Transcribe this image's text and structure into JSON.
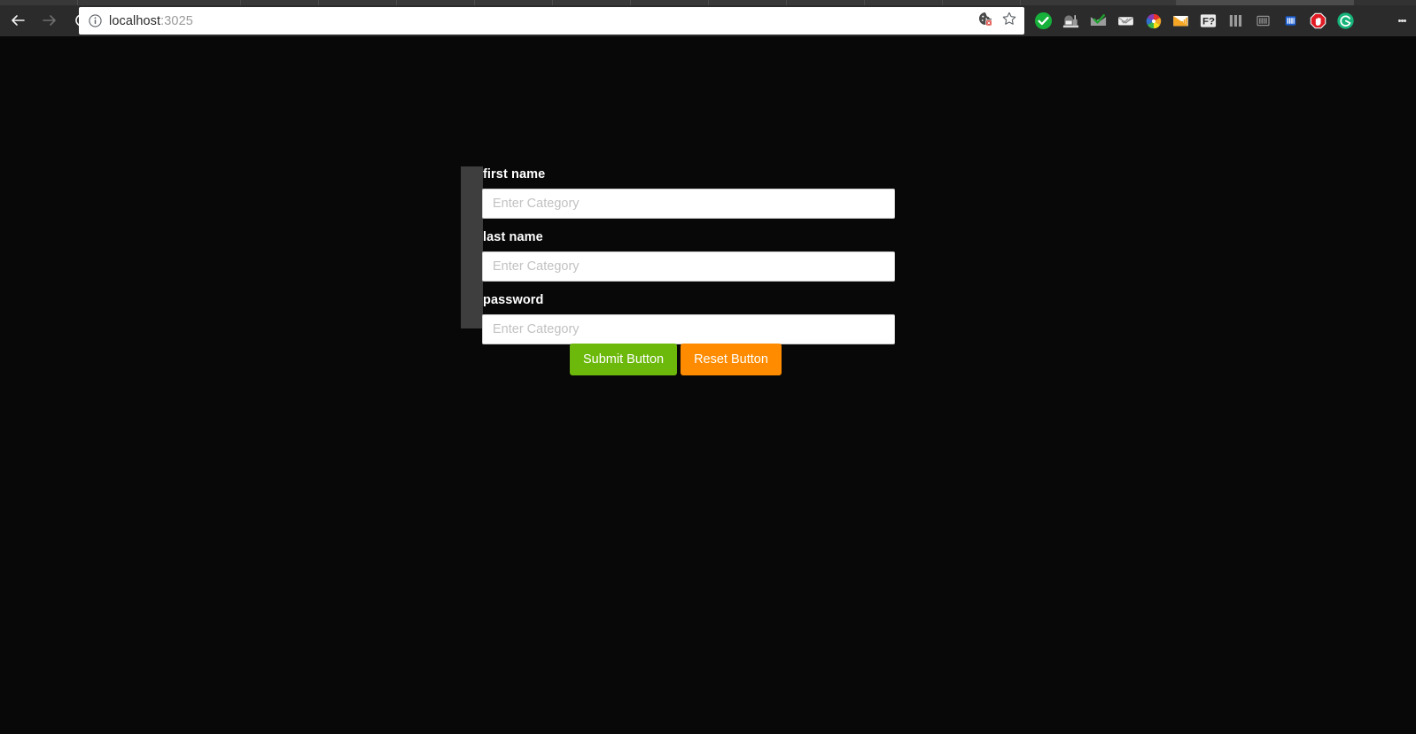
{
  "browser": {
    "nav": {
      "back_label": "Back",
      "forward_label": "Forward",
      "reload_label": "Reload"
    },
    "omnibox": {
      "page_info_icon": "info-circle-icon",
      "url_host": "localhost",
      "url_port": ":3025",
      "cookie_blocked_icon": "cookie-blocked-icon",
      "bookmark_icon": "star-outline-icon"
    },
    "extensions": [
      {
        "name": "green-check-icon",
        "title": "green check"
      },
      {
        "name": "mailbox-icon",
        "title": "mailbox"
      },
      {
        "name": "envelope-check-icon",
        "title": "envelope with check"
      },
      {
        "name": "envelope-icon",
        "title": "envelope"
      },
      {
        "name": "color-wheel-icon",
        "title": "color wheel"
      },
      {
        "name": "envelope-chart-icon",
        "title": "envelope chart"
      },
      {
        "name": "f-question-icon",
        "title": "F?"
      },
      {
        "name": "gray-bars-icon",
        "title": "gray bars"
      },
      {
        "name": "barcode-icon",
        "title": "barcode"
      },
      {
        "name": "blue-bars-icon",
        "title": "blue bars"
      },
      {
        "name": "adblock-stop-icon",
        "title": "adblock stop hand"
      },
      {
        "name": "grammarly-g-icon",
        "title": "Grammarly G"
      }
    ],
    "menu": {
      "name": "three-dot-menu-icon",
      "label": "Customize and control"
    }
  },
  "page": {
    "background_color": "#080808",
    "accent_bar_color": "#3e3e3e",
    "form": {
      "fields": [
        {
          "label": "first name",
          "placeholder": "Enter Category",
          "value": "",
          "type": "text"
        },
        {
          "label": "last name",
          "placeholder": "Enter Category",
          "value": "",
          "type": "text"
        },
        {
          "label": "password",
          "placeholder": "Enter Category",
          "value": "",
          "type": "text"
        }
      ],
      "buttons": {
        "submit_label": "Submit Button",
        "submit_color": "#6cb90c",
        "reset_label": "Reset Button",
        "reset_color": "#ff8c00"
      }
    }
  }
}
